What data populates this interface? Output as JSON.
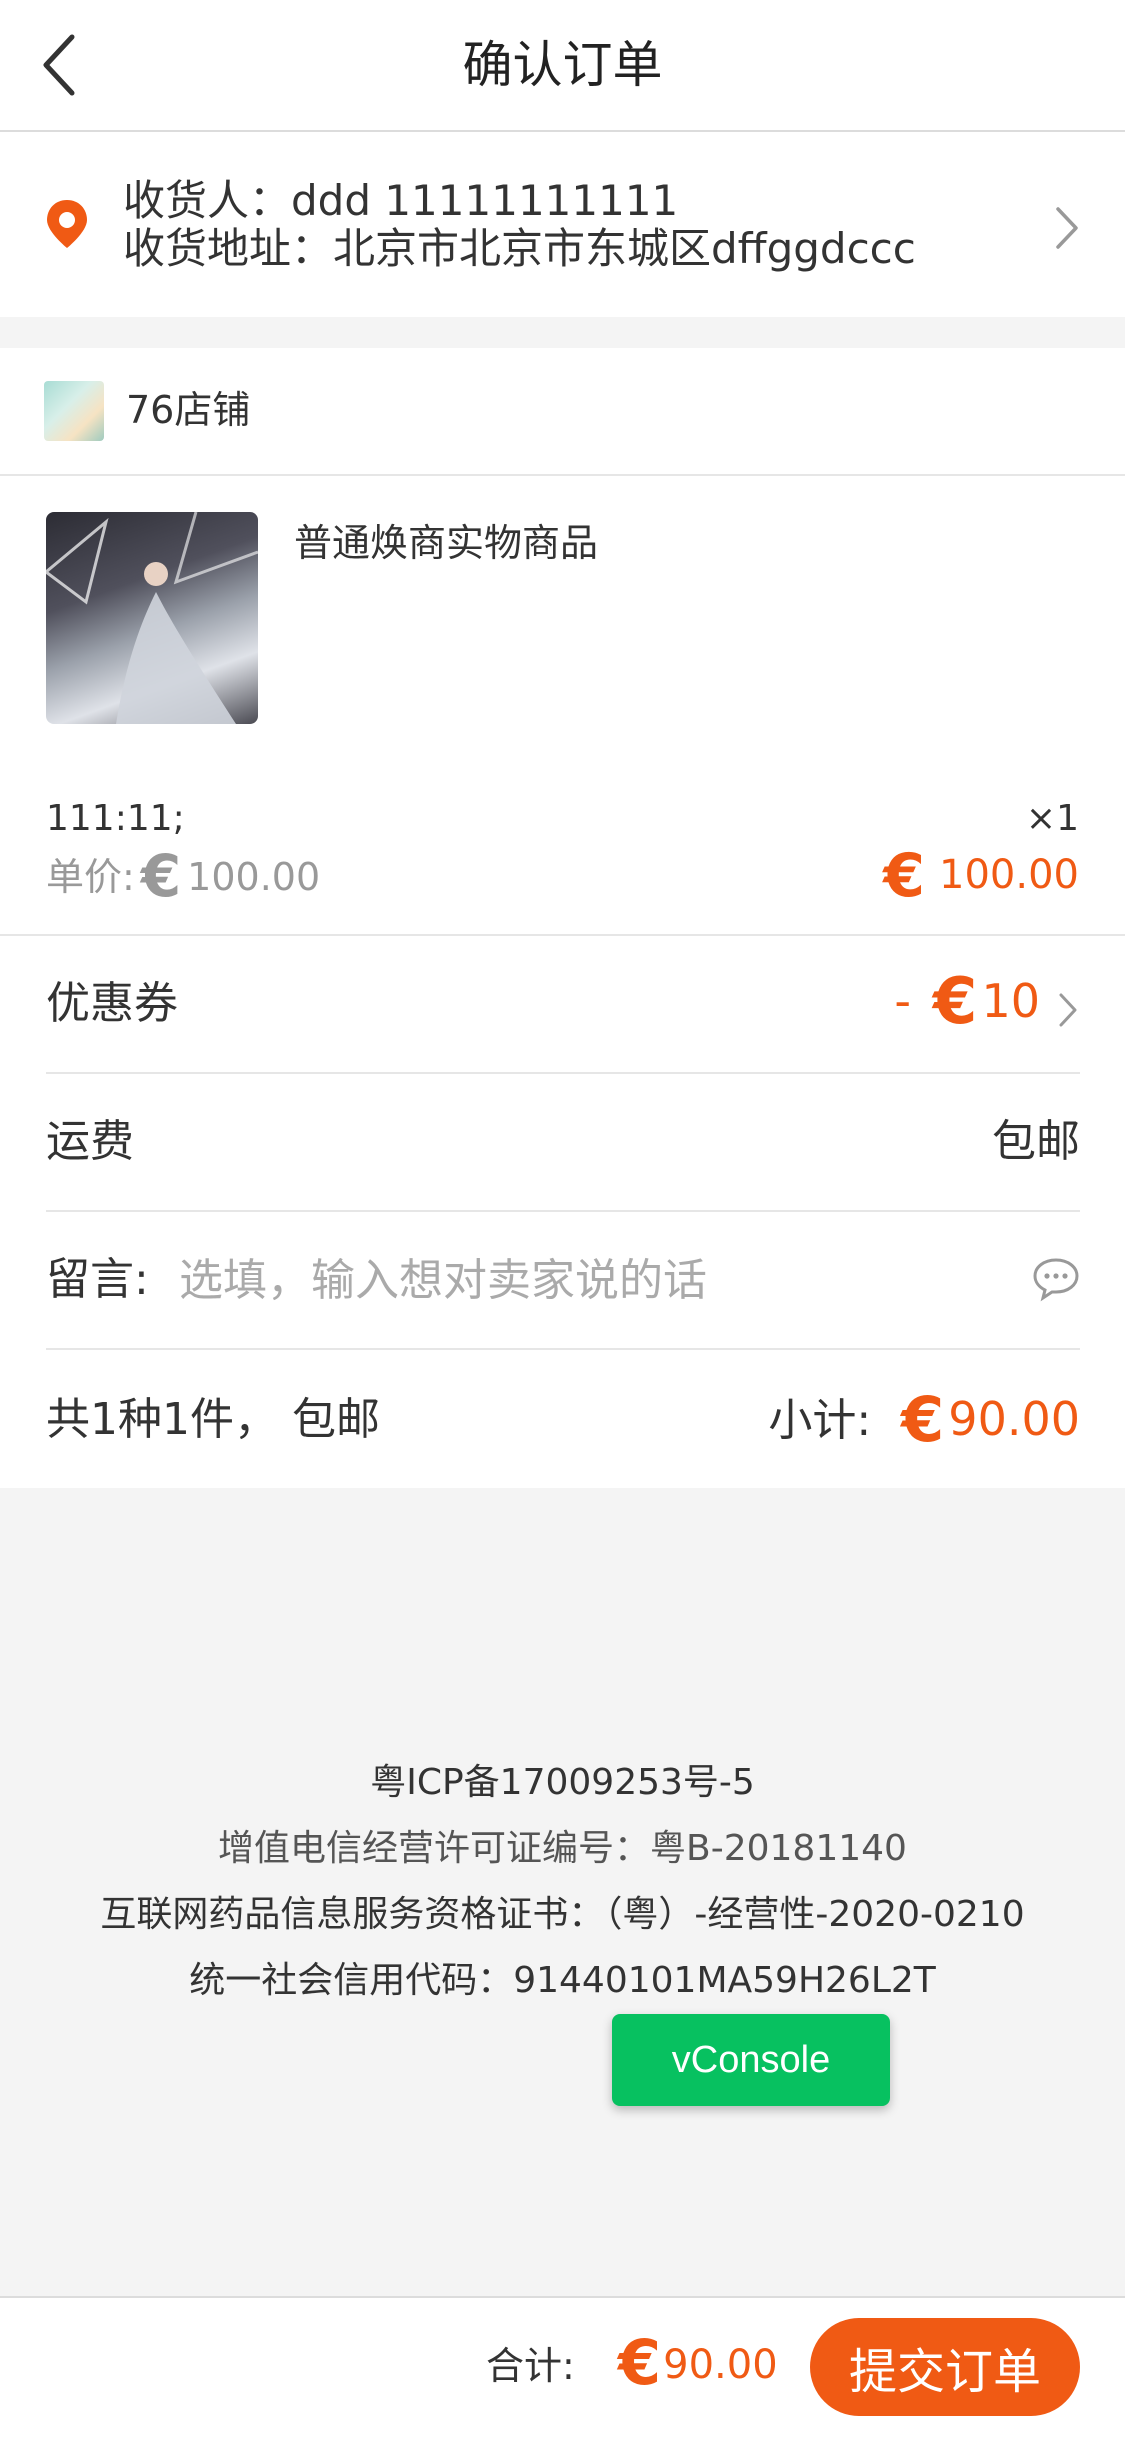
{
  "header": {
    "title": "确认订单"
  },
  "address": {
    "receiver_line": "收货人：ddd 11111111111",
    "address_line": "收货地址：北京市北京市东城区dffggdccc"
  },
  "shop": {
    "name": "76店铺"
  },
  "product": {
    "name": "普通焕商实物商品",
    "sku": "111:11;",
    "quantity": "×1",
    "unit_price_label": "单价:",
    "currency": "€",
    "unit_price": "100.00",
    "item_price": "100.00"
  },
  "coupon": {
    "label": "优惠券",
    "prefix": "-",
    "currency": "€",
    "value": "10"
  },
  "shipping": {
    "label": "运费",
    "value": "包邮"
  },
  "message": {
    "label": "留言:",
    "placeholder": "选填，输入想对卖家说的话"
  },
  "summary": {
    "count_text": "共1种1件，  包邮",
    "subtotal_label": "小计:",
    "currency": "€",
    "subtotal": "90.00"
  },
  "footer": {
    "lines": [
      "粤ICP备17009253号-5",
      "增值电信经营许可证编号：粤B-20181140",
      "互联网药品信息服务资格证书：（粤）-经营性-2020-0210",
      "统一社会信用代码：91440101MA59H26L2T"
    ],
    "vconsole_label": "vConsole"
  },
  "bottom_bar": {
    "total_label": "合计:",
    "currency": "€",
    "total": "90.00",
    "submit_label": "提交订单"
  },
  "colors": {
    "accent": "#f05a14",
    "vconsole": "#07c160",
    "background": "#f4f4f4"
  },
  "icons": [
    "back-arrow-icon",
    "location-pin-icon",
    "chevron-right-icon",
    "chat-bubble-icon"
  ]
}
